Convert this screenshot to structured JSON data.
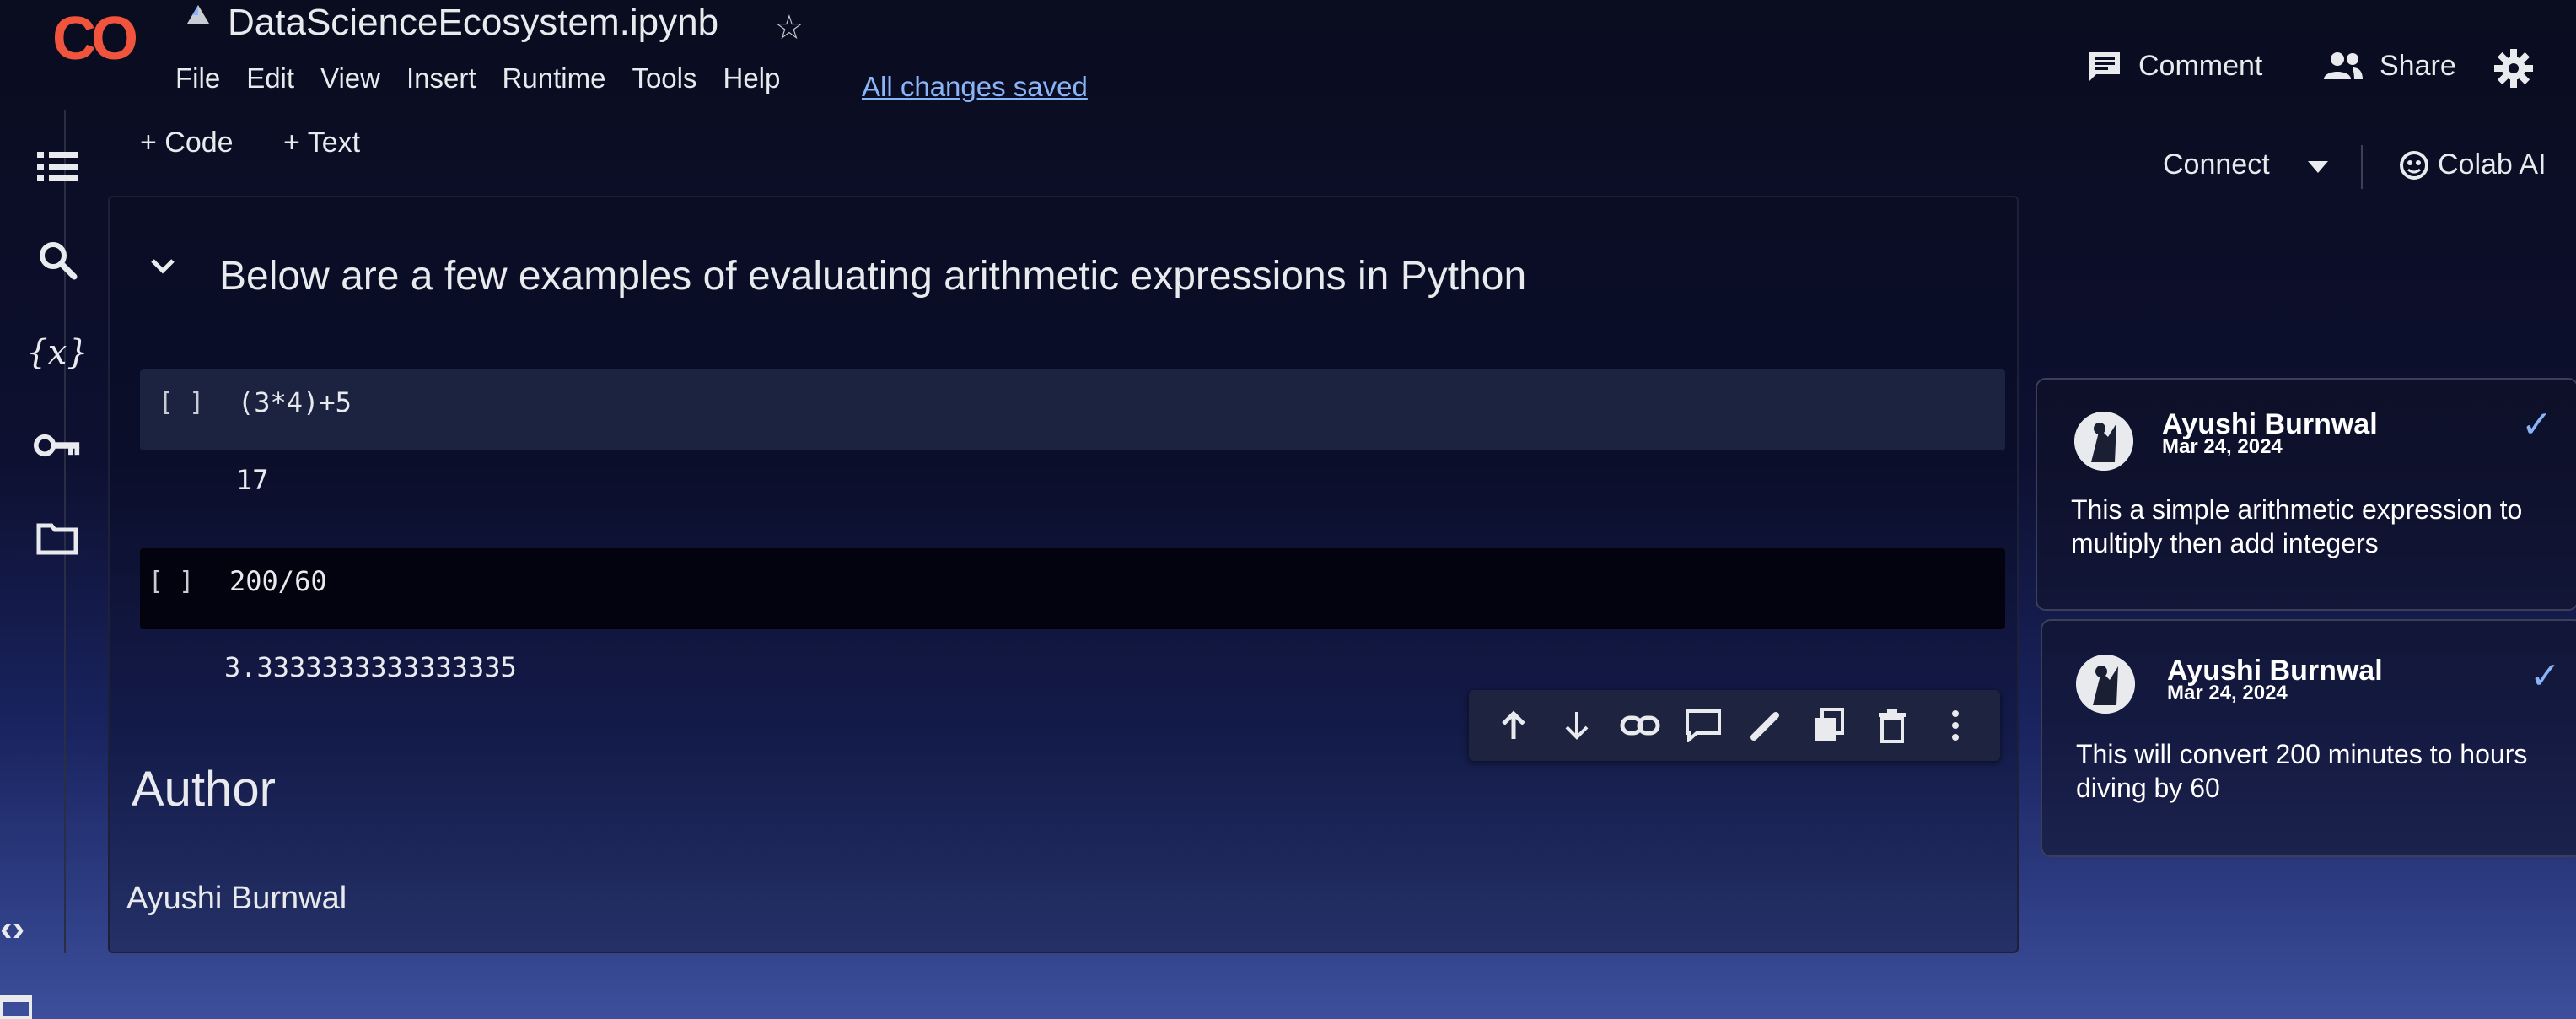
{
  "app": {
    "logo_text": "CO",
    "file_title": "DataScienceEcosystem.ipynb"
  },
  "menu": [
    "File",
    "Edit",
    "View",
    "Insert",
    "Runtime",
    "Tools",
    "Help"
  ],
  "save_status": "All changes saved",
  "header_actions": {
    "comment": "Comment",
    "share": "Share"
  },
  "toolbar": {
    "add_code": "+ Code",
    "add_text": "+ Text",
    "connect": "Connect",
    "colab_ai": "Colab AI"
  },
  "sidebar_icons": [
    "table-of-contents-icon",
    "search-icon",
    "variables-icon",
    "secrets-key-icon",
    "files-folder-icon",
    "code-snippets-icon",
    "terminal-icon"
  ],
  "sidebar_variables_label": "{x}",
  "notebook": {
    "section_heading": "Below are a few examples of evaluating arithmetic expressions in Python",
    "cells": [
      {
        "bracket": "[ ]",
        "code": "(3*4)+5",
        "output": "17"
      },
      {
        "bracket": "[ ]",
        "code": "200/60",
        "output": "3.3333333333333335"
      }
    ],
    "author_heading": "Author",
    "author_name": "Ayushi Burnwal"
  },
  "cell_toolbar_icons": [
    "move-up-icon",
    "move-down-icon",
    "link-icon",
    "comment-icon",
    "edit-icon",
    "copy-icon",
    "delete-icon",
    "more-options-icon"
  ],
  "comments": [
    {
      "author": "Ayushi Burnwal",
      "date": "Mar 24, 2024",
      "text": "This a simple arithmetic expression to multiply then add integers"
    },
    {
      "author": "Ayushi Burnwal",
      "date": "Mar 24, 2024",
      "text": "This will convert 200 minutes to hours diving by 60"
    }
  ],
  "colors": {
    "logo": "#f0543c",
    "link": "#8ab4f8",
    "background": "#0b0e24"
  }
}
